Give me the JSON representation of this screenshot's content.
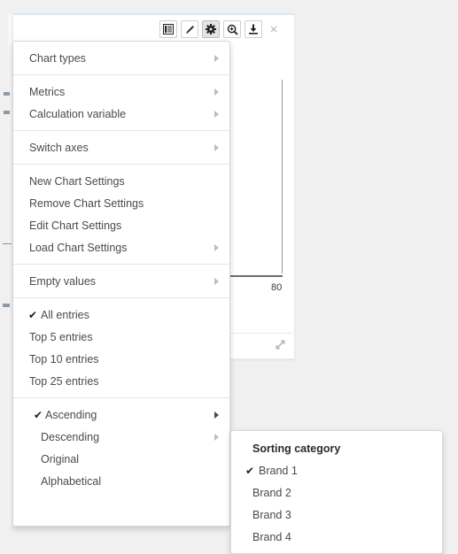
{
  "chart_panel": {
    "toolbar": [
      {
        "name": "table-view-icon",
        "title": "Table view",
        "active": false
      },
      {
        "name": "edit-pencil-icon",
        "title": "Edit",
        "active": false
      },
      {
        "name": "gear-icon",
        "title": "Chart settings",
        "active": true
      },
      {
        "name": "zoom-search-icon",
        "title": "Zoom",
        "active": false
      },
      {
        "name": "download-icon",
        "title": "Download",
        "active": false
      }
    ],
    "close_label": "×",
    "axis_tick_label": "80"
  },
  "settings_menu": {
    "groups": [
      {
        "items": [
          {
            "label": "Chart types",
            "submenu": true,
            "checked": false
          }
        ]
      },
      {
        "items": [
          {
            "label": "Metrics",
            "submenu": true,
            "checked": false
          },
          {
            "label": "Calculation variable",
            "submenu": true,
            "checked": false
          }
        ]
      },
      {
        "items": [
          {
            "label": "Switch axes",
            "submenu": true,
            "checked": false
          }
        ]
      },
      {
        "items": [
          {
            "label": "New Chart Settings",
            "submenu": false,
            "checked": false
          },
          {
            "label": "Remove Chart Settings",
            "submenu": false,
            "checked": false
          },
          {
            "label": "Edit Chart Settings",
            "submenu": false,
            "checked": false
          },
          {
            "label": "Load Chart Settings",
            "submenu": true,
            "checked": false
          }
        ]
      },
      {
        "items": [
          {
            "label": "Empty values",
            "submenu": true,
            "checked": false
          }
        ]
      },
      {
        "items": [
          {
            "label": "All entries",
            "submenu": false,
            "checked": true
          },
          {
            "label": "Top 5 entries",
            "submenu": false,
            "checked": false
          },
          {
            "label": "Top 10 entries",
            "submenu": false,
            "checked": false
          },
          {
            "label": "Top 25 entries",
            "submenu": false,
            "checked": false
          }
        ]
      },
      {
        "items": [
          {
            "label": "Ascending",
            "submenu": true,
            "checked": true,
            "indent": true
          },
          {
            "label": "Descending",
            "submenu": true,
            "checked": false,
            "indent": true
          },
          {
            "label": "Original",
            "submenu": false,
            "checked": false,
            "indent": true
          },
          {
            "label": "Alphabetical",
            "submenu": false,
            "checked": false,
            "indent": true
          }
        ]
      }
    ]
  },
  "sorting_submenu": {
    "header": "Sorting category",
    "items": [
      {
        "label": "Brand 1",
        "checked": true
      },
      {
        "label": "Brand 2",
        "checked": false
      },
      {
        "label": "Brand 3",
        "checked": false
      },
      {
        "label": "Brand 4",
        "checked": false
      }
    ]
  },
  "colors": {
    "menu_text": "#4a4a4a",
    "header_text": "#2b2b2b",
    "check_mark": "#1d1d1d",
    "panel_bg": "#ffffff",
    "page_bg": "#f0f0f0",
    "accent_border": "#dce8f2"
  }
}
